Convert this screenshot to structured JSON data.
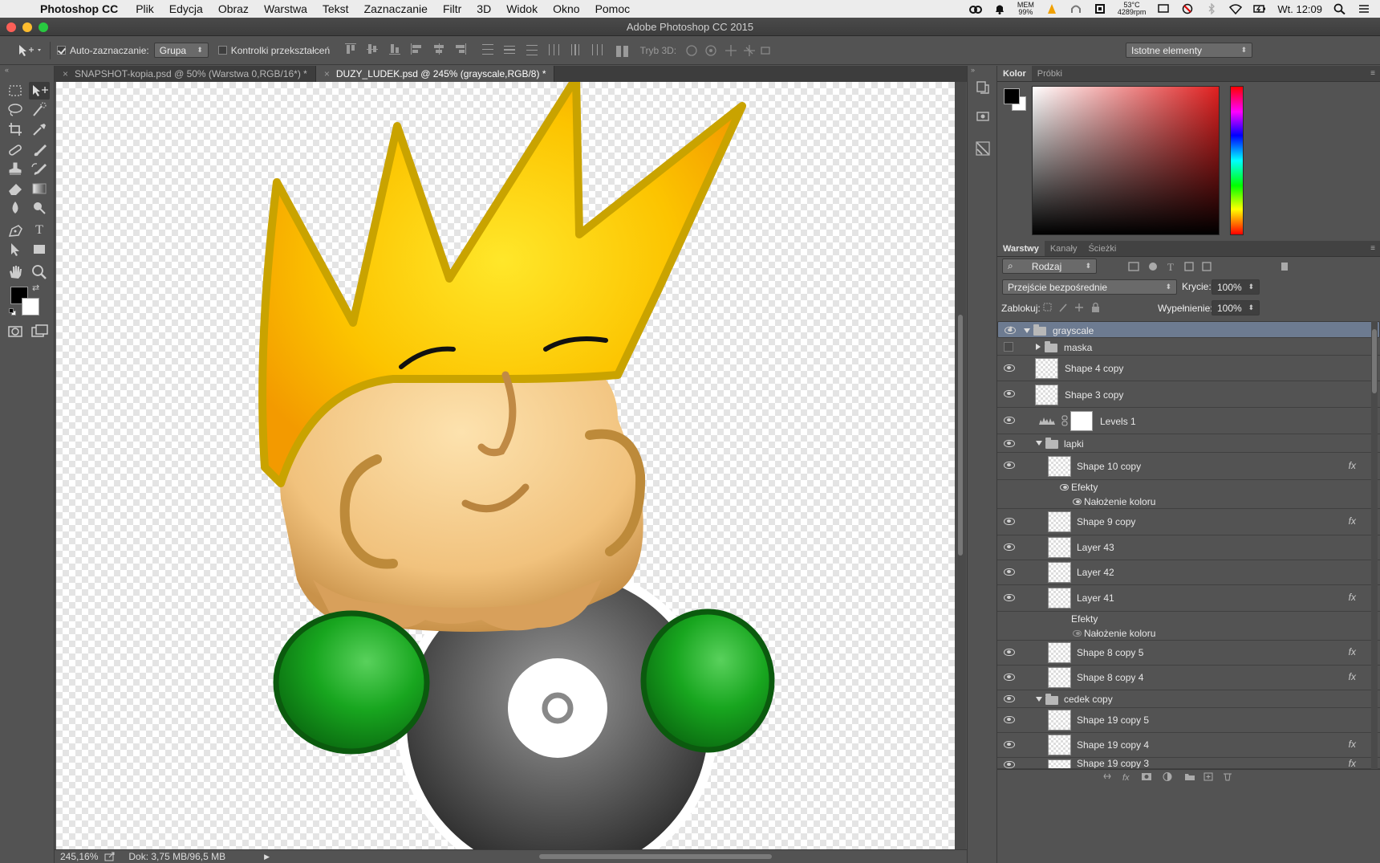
{
  "menubar": {
    "app_name": "Photoshop CC",
    "items": [
      "Plik",
      "Edycja",
      "Obraz",
      "Warstwa",
      "Tekst",
      "Zaznaczanie",
      "Filtr",
      "3D",
      "Widok",
      "Okno",
      "Pomoc"
    ],
    "mem_label": "MEM",
    "mem_value": "99%",
    "temp_value": "53°C",
    "rpm_value": "4289rpm",
    "clock": "Wt. 12:09"
  },
  "window": {
    "title": "Adobe Photoshop CC 2015"
  },
  "options_bar": {
    "auto_select_label": "Auto-zaznaczanie:",
    "auto_select_checked": true,
    "auto_select_value": "Grupa",
    "transform_controls_label": "Kontrolki przekształceń",
    "mode_3d_label": "Tryb 3D:",
    "workspace_value": "Istotne elementy"
  },
  "doc_tabs": [
    {
      "title": "SNAPSHOT-kopia.psd @ 50% (Warstwa 0,RGB/16*) *",
      "active": false
    },
    {
      "title": "DUZY_LUDEK.psd @ 245% (grayscale,RGB/8) *",
      "active": true
    }
  ],
  "status_bar": {
    "zoom": "245,16%",
    "doc_size": "Dok: 3,75 MB/96,5 MB"
  },
  "colors": {
    "foreground": "#000000",
    "background": "#ffffff",
    "selected_row": "#6d7b91"
  },
  "color_panel": {
    "tabs": [
      "Kolor",
      "Próbki"
    ]
  },
  "layers_panel": {
    "tabs": [
      "Warstwy",
      "Kanały",
      "Ścieżki"
    ],
    "filter_value": "Rodzaj",
    "blend_mode": "Przejście bezpośrednie",
    "opacity_label": "Krycie:",
    "opacity_value": "100%",
    "lock_label": "Zablokuj:",
    "fill_label": "Wypełnienie:",
    "fill_value": "100%",
    "rows": {
      "grayscale": "grayscale",
      "maska": "maska",
      "shape4": "Shape 4 copy",
      "shape3": "Shape 3 copy",
      "levels1": "Levels 1",
      "lapki": "lapki",
      "shape10": "Shape 10 copy",
      "efekty1": "Efekty",
      "nalozenie1": "Nałożenie koloru",
      "shape9": "Shape 9 copy",
      "layer43": "Layer 43",
      "layer42": "Layer 42",
      "layer41": "Layer 41",
      "efekty2": "Efekty",
      "nalozenie2": "Nałożenie koloru",
      "shape8_5": "Shape 8 copy 5",
      "shape8_4": "Shape 8 copy 4",
      "cedek": "cedek copy",
      "shape19_5": "Shape 19 copy 5",
      "shape19_4": "Shape 19 copy 4",
      "shape19_3": "Shape 19 copy 3"
    },
    "fx_symbol": "fx"
  },
  "icons": {
    "apple": "",
    "close_tab": "×",
    "menu": "≡",
    "text_tool": "T"
  }
}
